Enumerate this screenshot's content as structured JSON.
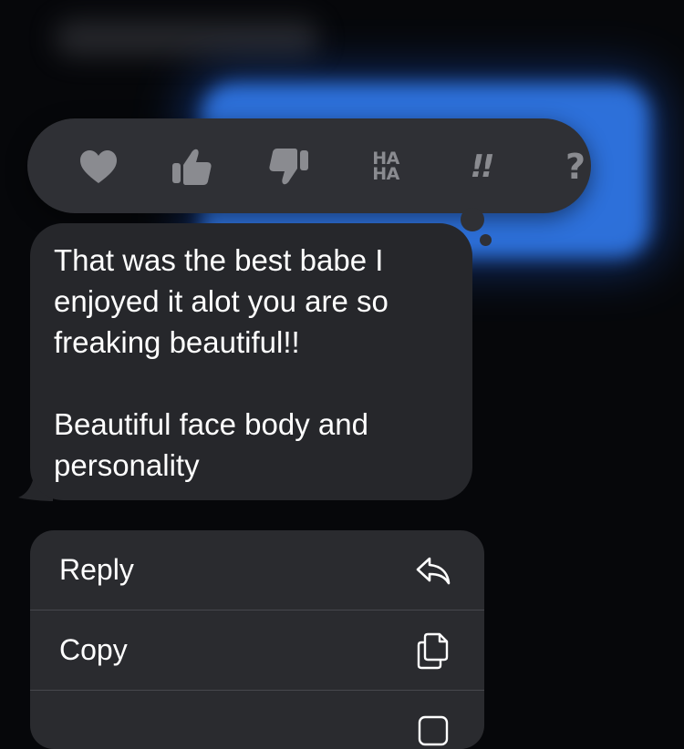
{
  "tapback": {
    "reactions": [
      {
        "name": "heart",
        "label": ""
      },
      {
        "name": "thumbs-up",
        "label": ""
      },
      {
        "name": "thumbs-down",
        "label": ""
      },
      {
        "name": "haha",
        "label_line1": "HA",
        "label_line2": "HA"
      },
      {
        "name": "exclamation",
        "label": "!!"
      },
      {
        "name": "question",
        "label": "?"
      }
    ],
    "icon_color": "#8a8b90",
    "background": "#2f3035"
  },
  "message": {
    "paragraph1": "That was the best babe I\nenjoyed it alot you are so\nfreaking beautiful!!",
    "paragraph2": "Beautiful face body and\npersonality",
    "bubble_color": "#26272b",
    "text_color": "#ffffff"
  },
  "context_menu": {
    "items": [
      {
        "label": "Reply",
        "icon": "reply-arrow-icon"
      },
      {
        "label": "Copy",
        "icon": "copy-documents-icon"
      }
    ],
    "background": "#2a2b2f"
  },
  "backdrop": {
    "sent_bubble_color": "#2f74e0",
    "background": "#06070a"
  }
}
